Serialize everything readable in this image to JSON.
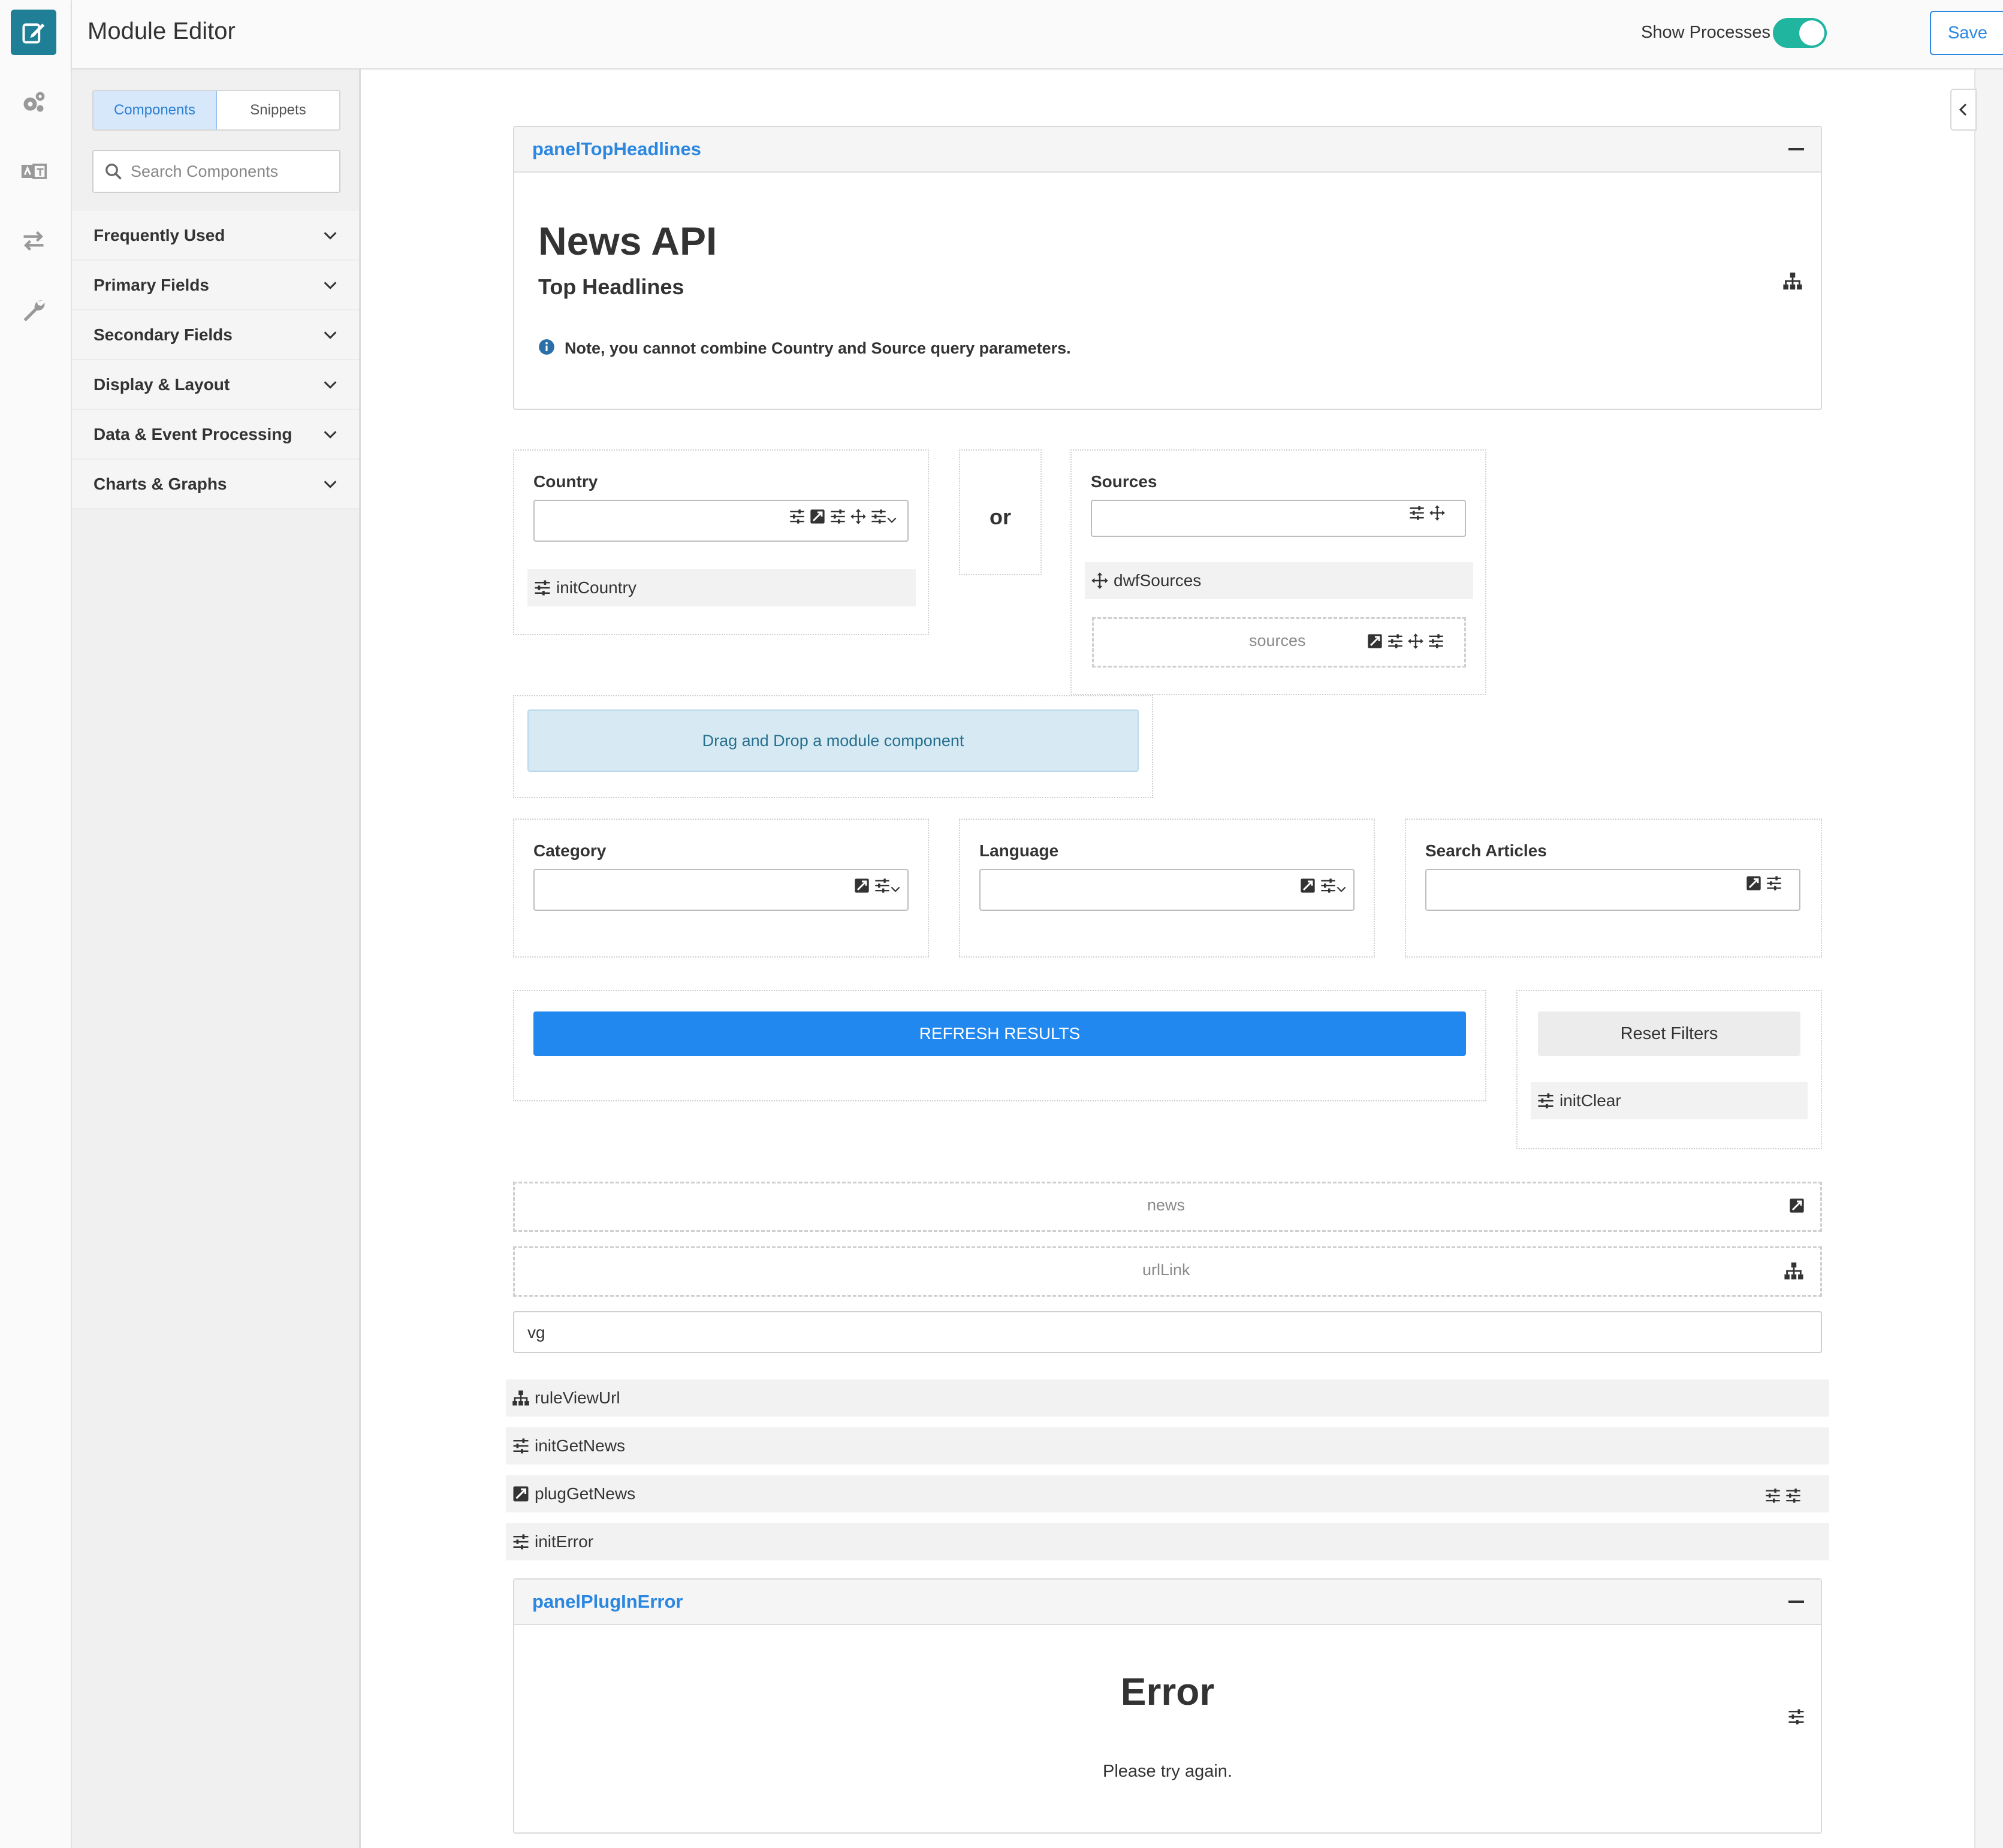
{
  "header": {
    "title": "Module Editor",
    "show_processes_label": "Show Processes",
    "save_label": "Save",
    "more_label": "•••"
  },
  "rail": {
    "icons": [
      "edit-icon",
      "settings-gears-icon",
      "translate-icon",
      "swap-arrows-icon",
      "wrench-icon"
    ]
  },
  "sidebar": {
    "tabs": [
      "Components",
      "Snippets"
    ],
    "search_placeholder": "Search Components",
    "categories": [
      "Frequently Used",
      "Primary Fields",
      "Secondary Fields",
      "Display & Layout",
      "Data & Event Processing",
      "Charts & Graphs"
    ]
  },
  "canvas": {
    "panel_top": {
      "title": "panelTopHeadlines",
      "heading": "News API",
      "subheading": "Top Headlines",
      "note": "Note, you cannot combine Country and Source query parameters."
    },
    "country": {
      "label": "Country",
      "process": "initCountry"
    },
    "or_text": "or",
    "sources": {
      "label": "Sources",
      "process": "dwfSources",
      "variable": "sources"
    },
    "dropzone_text": "Drag and Drop a module component",
    "category": {
      "label": "Category"
    },
    "language": {
      "label": "Language"
    },
    "search_articles": {
      "label": "Search Articles"
    },
    "refresh_label": "REFRESH RESULTS",
    "reset_label": "Reset Filters",
    "reset_process": "initClear",
    "news_var": "news",
    "urllink_var": "urlLink",
    "vg_value": "vg",
    "processes": [
      "ruleViewUrl",
      "initGetNews",
      "plugGetNews",
      "initError"
    ],
    "panel_error": {
      "title": "panelPlugInError",
      "heading": "Error",
      "message": "Please try again."
    }
  },
  "colors": {
    "accent": "#2b87e0",
    "rail_active": "#1f7f96",
    "toggle_on": "#1fb59f",
    "refresh_button": "#2188f0"
  }
}
